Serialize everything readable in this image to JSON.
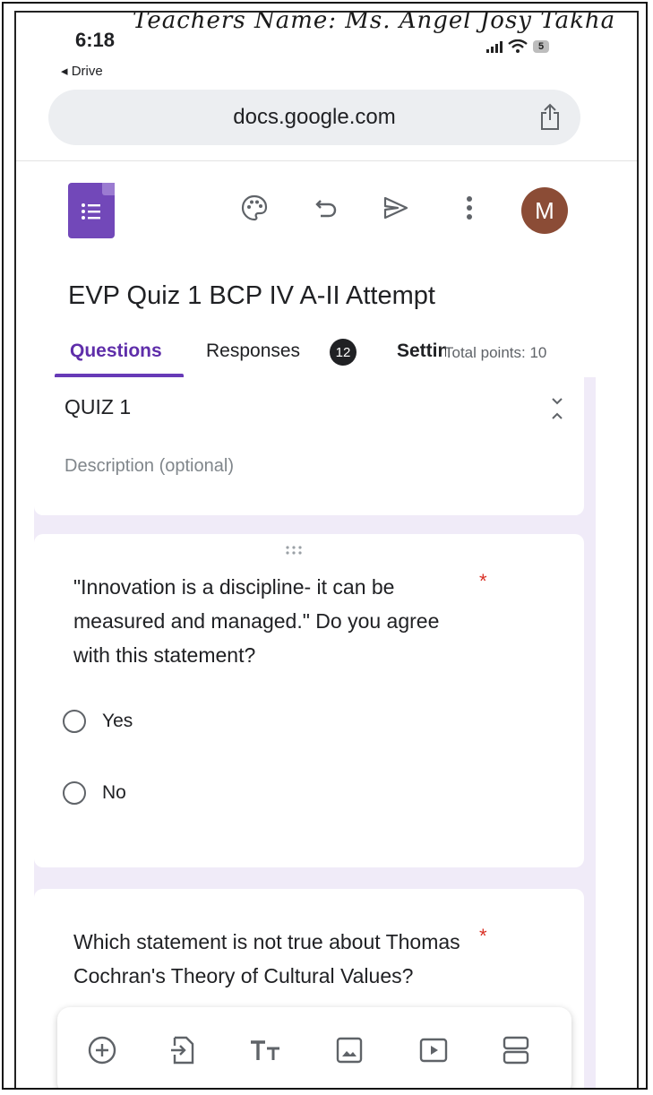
{
  "status_bar": {
    "time": "6:18",
    "back_label": "◂ Drive",
    "handwritten_note": "Teachers Name: Ms. Angel Josy Takha",
    "battery": "5"
  },
  "browser": {
    "url": "docs.google.com"
  },
  "header": {
    "avatar_letter": "M",
    "form_title": "EVP Quiz 1 BCP IV A-II Attempt"
  },
  "tabs": {
    "questions": "Questions",
    "responses": "Responses",
    "responses_count": "12",
    "settings": "Settings",
    "total_points": "Total points: 10"
  },
  "title_card": {
    "title": "QUIZ 1",
    "description_placeholder": "Description (optional)"
  },
  "questions": [
    {
      "text": "\"Innovation is a discipline- it can be measured and managed.\" Do you agree with this statement?",
      "required_mark": "*",
      "options": [
        "Yes",
        "No"
      ]
    },
    {
      "text": "Which statement is not true about Thomas Cochran's Theory of Cultural Values?",
      "required_mark": "*"
    }
  ],
  "colors": {
    "accent": "#673ab7",
    "forms_logo": "#7248b9",
    "avatar": "#8b4c36",
    "required": "#d93025",
    "background_tint": "#f0ebf8"
  },
  "icons": {
    "toolbar": [
      "palette-icon",
      "undo-icon",
      "send-icon",
      "more-vert-icon"
    ],
    "bottom": [
      "add-question-icon",
      "import-questions-icon",
      "add-title-icon",
      "add-image-icon",
      "add-video-icon",
      "add-section-icon"
    ]
  }
}
